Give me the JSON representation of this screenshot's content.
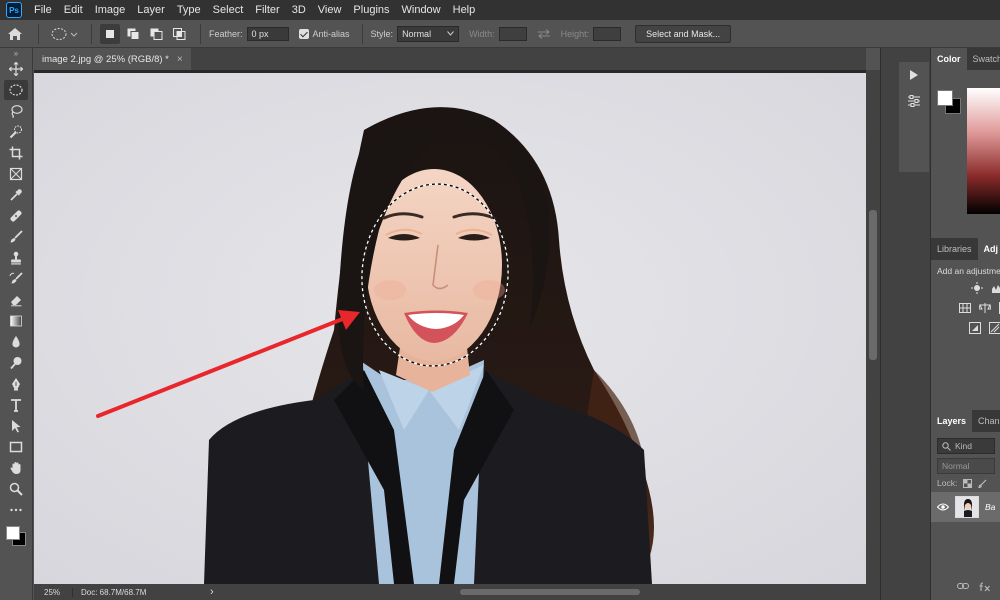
{
  "app": {
    "logo_text": "Ps"
  },
  "menu": [
    "File",
    "Edit",
    "Image",
    "Layer",
    "Type",
    "Select",
    "Filter",
    "3D",
    "View",
    "Plugins",
    "Window",
    "Help"
  ],
  "options": {
    "feather_label": "Feather:",
    "feather_value": "0 px",
    "anti_alias_label": "Anti-alias",
    "anti_alias_checked": true,
    "style_label": "Style:",
    "style_value": "Normal",
    "width_label": "Width:",
    "height_label": "Height:",
    "select_mask_label": "Select and Mask..."
  },
  "document": {
    "tab_title": "image 2.jpg @ 25% (RGB/8) *",
    "close_glyph": "×"
  },
  "status": {
    "zoom": "25%",
    "doc_info": "Doc: 68.7M/68.7M",
    "arrow_glyph": "›"
  },
  "panels": {
    "color_tabs": [
      "Color",
      "Swatch"
    ],
    "adjust_tabs": [
      "Libraries",
      "Adj"
    ],
    "adjust_hint": "Add an adjustme",
    "layers_tabs": [
      "Layers",
      "Chann"
    ],
    "layers_search": "Kind",
    "blend_mode": "Normal",
    "lock_label": "Lock:",
    "layer_name": "Ba"
  },
  "colors": {
    "foreground": "#ffffff",
    "background": "#000000",
    "annotation_arrow": "#e8262b",
    "accent": "#31a8ff"
  },
  "icons": {
    "toolbar": [
      "move-icon",
      "elliptical-marquee-icon",
      "lasso-icon",
      "quick-selection-icon",
      "crop-icon",
      "frame-icon",
      "eyedropper-icon",
      "healing-brush-icon",
      "brush-icon",
      "clone-stamp-icon",
      "history-brush-icon",
      "eraser-icon",
      "gradient-icon",
      "blur-icon",
      "dodge-icon",
      "pen-icon",
      "type-icon",
      "path-selection-icon",
      "rectangle-icon",
      "hand-icon",
      "zoom-icon",
      "more-tools-icon"
    ]
  }
}
